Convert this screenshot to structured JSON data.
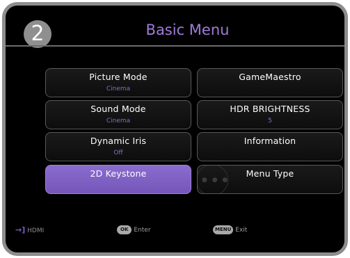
{
  "step_number": "2",
  "title": "Basic Menu",
  "tiles": [
    {
      "label": "Picture Mode",
      "value": "Cinema"
    },
    {
      "label": "GameMaestro",
      "value": ""
    },
    {
      "label": "Sound Mode",
      "value": "Cinema"
    },
    {
      "label": "HDR BRIGHTNESS",
      "value": "5"
    },
    {
      "label": "Dynamic Iris",
      "value": "Off"
    },
    {
      "label": "Information",
      "value": ""
    },
    {
      "label": "2D Keystone",
      "value": ""
    },
    {
      "label": "Menu Type",
      "value": ""
    }
  ],
  "footer": {
    "source_icon": "input-arrow-icon",
    "source_label": "HDMI",
    "ok_key": "OK",
    "ok_label": "Enter",
    "menu_key": "MENU",
    "menu_label": "Exit"
  },
  "colors": {
    "accent": "#8a6cd0",
    "title": "#a07cd6",
    "frame": "#8d8d8d",
    "background": "#000000"
  }
}
